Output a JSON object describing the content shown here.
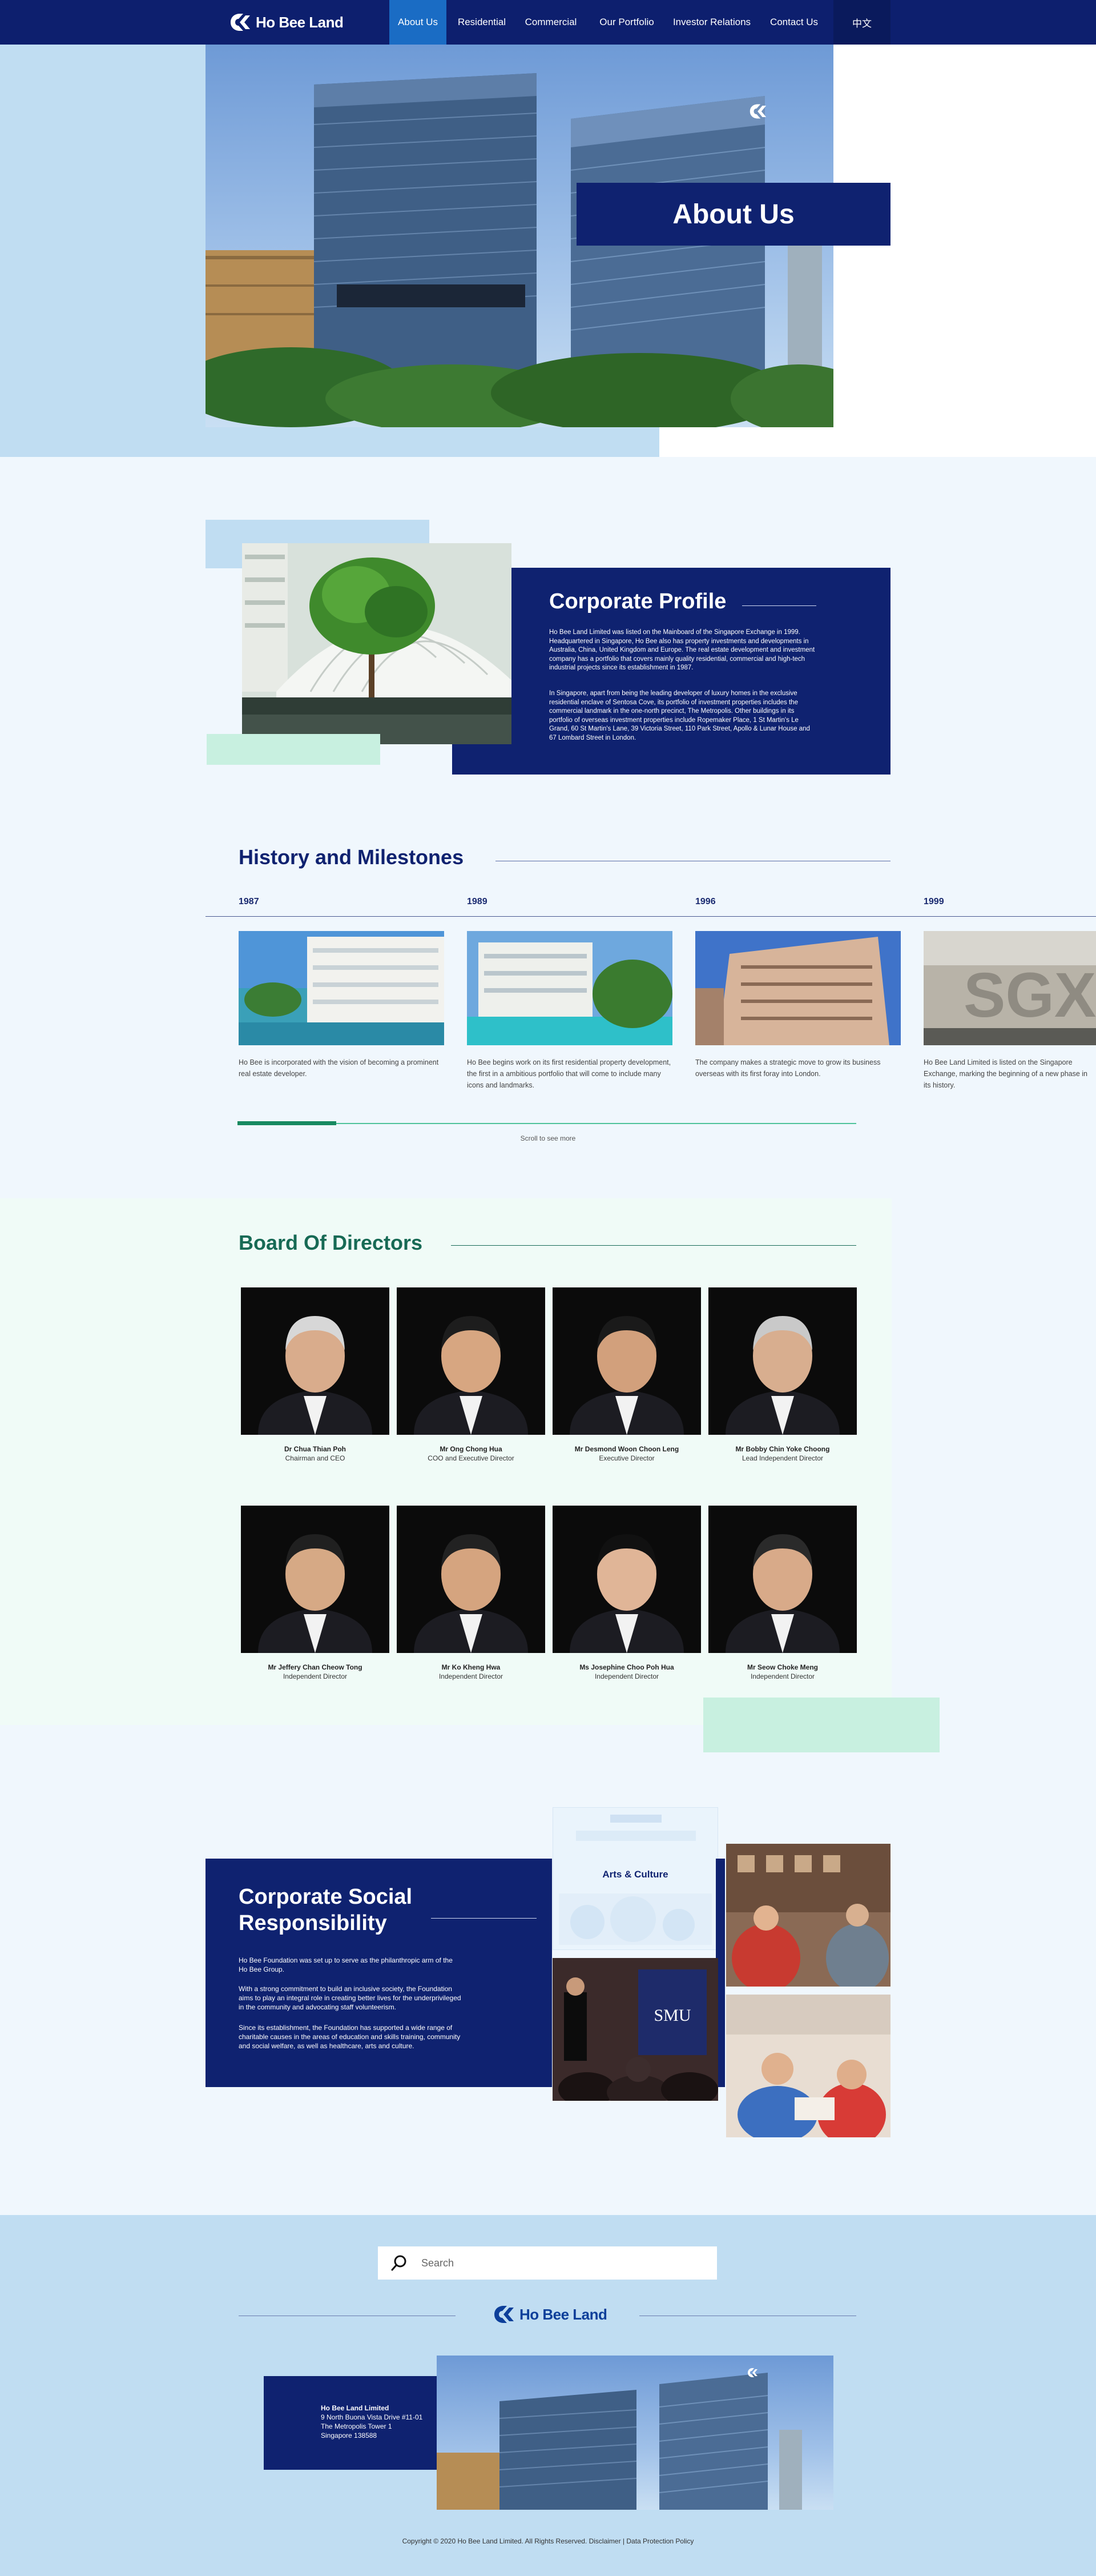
{
  "nav": {
    "logo_text": "Ho Bee Land",
    "items": [
      {
        "label": "About Us"
      },
      {
        "label": "Residential"
      },
      {
        "label": "Commercial"
      },
      {
        "label": "Our Portfolio"
      },
      {
        "label": "Investor Relations"
      },
      {
        "label": "Contact Us"
      }
    ],
    "lang": "中文"
  },
  "hero": {
    "title": "About Us"
  },
  "profile": {
    "title": "Corporate Profile",
    "para1": "Ho Bee Land Limited was listed on the Mainboard of the Singapore Exchange in 1999. Headquartered in Singapore, Ho Bee also has property investments and developments in Australia, China, United Kingdom and Europe. The real estate development and investment company has a portfolio that covers mainly quality residential, commercial and high-tech industrial projects since its establishment in 1987.",
    "para2": "In Singapore, apart from being the leading developer of luxury homes in the exclusive residential enclave of Sentosa Cove, its portfolio of investment properties includes the commercial landmark in the one-north precinct, The Metropolis. Other buildings in its portfolio of overseas investment properties include Ropemaker Place, 1 St Martin's Le Grand, 60 St Martin's Lane, 39 Victoria Street, 110 Park Street, Apollo & Lunar House and 67 Lombard Street in London."
  },
  "history": {
    "title": "History and Milestones",
    "milestones": [
      {
        "year": "1987",
        "text": "Ho Bee is incorporated with the vision of becoming a prominent real estate developer."
      },
      {
        "year": "1989",
        "text": "Ho Bee begins work on its first residential property development, the first in a ambitious portfolio that will come to include many icons and landmarks."
      },
      {
        "year": "1996",
        "text": "The company makes a strategic move to grow its business overseas with its first foray into London."
      },
      {
        "year": "1999",
        "text": "Ho Bee Land Limited is listed on the Singapore Exchange, marking the beginning of a new phase in its history."
      }
    ],
    "scroll_hint": "Scroll to see more",
    "scroll_progress": 0.16
  },
  "board": {
    "title": "Board Of Directors",
    "directors": [
      {
        "name": "Dr Chua Thian Poh",
        "role": "Chairman and CEO"
      },
      {
        "name": "Mr Ong Chong Hua",
        "role": "COO and Executive Director"
      },
      {
        "name": "Mr Desmond Woon Choon Leng",
        "role": "Executive Director"
      },
      {
        "name": "Mr Bobby Chin Yoke Choong",
        "role": "Lead Independent Director"
      },
      {
        "name": "Mr Jeffery Chan Cheow Tong",
        "role": "Independent Director"
      },
      {
        "name": "Mr Ko Kheng Hwa",
        "role": "Independent Director"
      },
      {
        "name": "Ms Josephine Choo Poh Hua",
        "role": "Independent Director"
      },
      {
        "name": "Mr Seow Choke Meng",
        "role": "Independent Director"
      }
    ]
  },
  "csr": {
    "title": "Corporate Social Responsibility",
    "para1": "Ho Bee Foundation was set up to serve as the philanthropic arm of the Ho Bee Group.",
    "para2": "With a strong commitment to build an inclusive society, the Foundation aims to play an integral role in creating better lives for the underprivileged in the community and advocating staff volunteerism.",
    "para3": "Since its establishment, the Foundation has supported a wide range of charitable causes in the areas of education and skills training, community and social welfare, as well as healthcare, arts and culture.",
    "arts_label": "Arts & Culture",
    "smu_label": "SMU"
  },
  "footer": {
    "search_placeholder": "Search",
    "logo_text": "Ho Bee Land",
    "address": {
      "company": "Ho Bee Land Limited",
      "line1": "9 North Buona Vista Drive #11-01",
      "line2": "The Metropolis Tower 1",
      "line3": "Singapore 138588"
    },
    "copyright": "Copyright © 2020 Ho Bee Land Limited. All Rights Reserved. Disclaimer | Data Protection Policy"
  },
  "colors": {
    "navy": "#0f2270",
    "nav_active": "#1a6cc4",
    "light_blue": "#c0ddf2",
    "mint": "#c8f0e0",
    "board_green": "#176a55"
  }
}
